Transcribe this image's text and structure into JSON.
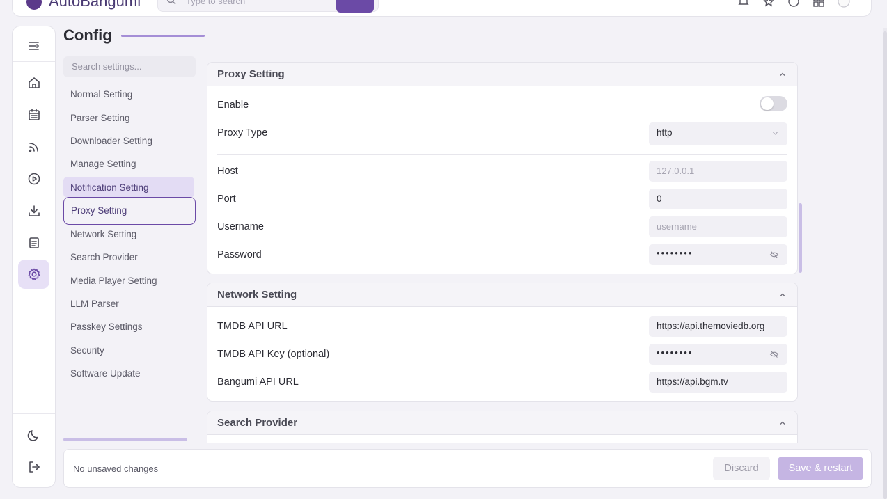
{
  "topbar": {
    "app_name": "AutoBangumi",
    "search_placeholder": "Type to search"
  },
  "page": {
    "title": "Config"
  },
  "nav": {
    "search_placeholder": "Search settings...",
    "items": [
      {
        "label": "Normal Setting"
      },
      {
        "label": "Parser Setting"
      },
      {
        "label": "Downloader Setting"
      },
      {
        "label": "Manage Setting"
      },
      {
        "label": "Notification Setting"
      },
      {
        "label": "Proxy Setting"
      },
      {
        "label": "Network Setting"
      },
      {
        "label": "Search Provider"
      },
      {
        "label": "Media Player Setting"
      },
      {
        "label": "LLM Parser"
      },
      {
        "label": "Passkey Settings"
      },
      {
        "label": "Security"
      },
      {
        "label": "Software Update"
      }
    ],
    "highlighted": "Notification Setting",
    "active": "Proxy Setting"
  },
  "proxy": {
    "title": "Proxy Setting",
    "enable_label": "Enable",
    "enabled": false,
    "type_label": "Proxy Type",
    "type_value": "http",
    "host_label": "Host",
    "host_placeholder": "127.0.0.1",
    "port_label": "Port",
    "port_value": "0",
    "username_label": "Username",
    "username_placeholder": "username",
    "password_label": "Password",
    "password_value": "••••••••"
  },
  "network": {
    "title": "Network Setting",
    "tmdb_url_label": "TMDB API URL",
    "tmdb_url_value": "https://api.themoviedb.org",
    "tmdb_key_label": "TMDB API Key (optional)",
    "tmdb_key_value": "••••••••",
    "bangumi_url_label": "Bangumi API URL",
    "bangumi_url_value": "https://api.bgm.tv"
  },
  "search_provider": {
    "title": "Search Provider"
  },
  "footer": {
    "status": "No unsaved changes",
    "discard_label": "Discard",
    "save_label": "Save & restart"
  },
  "colors": {
    "accent": "#6b4aa6",
    "accent_light": "#e7e0f6",
    "save_disabled": "#c5b5e3"
  }
}
